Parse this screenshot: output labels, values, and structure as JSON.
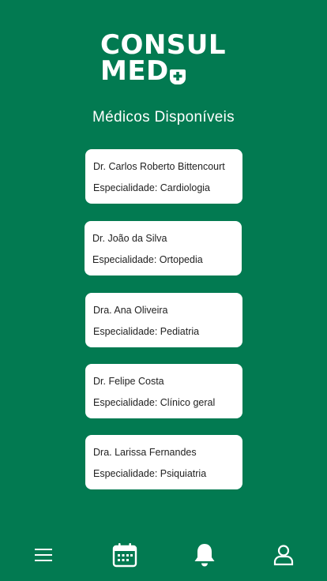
{
  "brand": {
    "line1": "CONSUL",
    "line2": "MED"
  },
  "page": {
    "title": "Médicos Disponíveis"
  },
  "doctors": [
    {
      "name": "Dr. Carlos Roberto Bittencourt",
      "specialty": "Especialidade: Cardiologia"
    },
    {
      "name": "Dr. João da Silva",
      "specialty": "Especialidade: Ortopedia"
    },
    {
      "name": "Dra. Ana Oliveira",
      "specialty": "Especialidade: Pediatria"
    },
    {
      "name": "Dr. Felipe Costa",
      "specialty": "Especialidade: Clínico geral"
    },
    {
      "name": "Dra. Larissa Fernandes",
      "specialty": "Especialidade: Psiquiatria"
    }
  ],
  "nav": {
    "items": [
      {
        "icon": "menu-icon"
      },
      {
        "icon": "calendar-icon"
      },
      {
        "icon": "bell-icon"
      },
      {
        "icon": "user-icon"
      }
    ]
  },
  "colors": {
    "background": "#027a51",
    "card": "#ffffff",
    "text_on_card": "#222222"
  }
}
